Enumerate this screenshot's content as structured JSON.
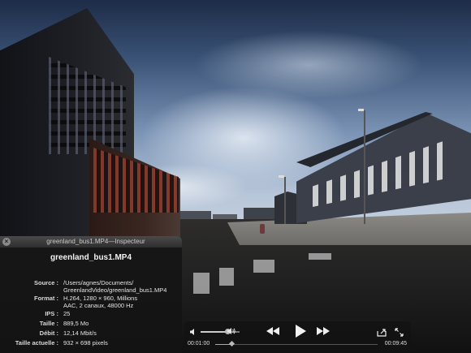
{
  "inspector": {
    "window_title": "greenland_bus1.MP4—Inspecteur",
    "filename": "greenland_bus1.MP4",
    "close_icon": "close-icon",
    "rows": [
      {
        "label": "Source :",
        "lines": [
          "/Users/agnes/Documents/",
          "GreenlandVideo/greenland_bus1.MP4"
        ]
      },
      {
        "label": "Format :",
        "lines": [
          "H.264, 1280 × 960, Millions",
          "AAC, 2 canaux, 48000 Hz"
        ]
      },
      {
        "label": "IPS :",
        "lines": [
          "25"
        ]
      },
      {
        "label": "Taille :",
        "lines": [
          "889,5 Mo"
        ]
      },
      {
        "label": "Débit :",
        "lines": [
          "12,14 Mbit/s"
        ]
      },
      {
        "label": "Taille actuelle :",
        "lines": [
          "932 × 698 pixels"
        ]
      }
    ]
  },
  "player": {
    "time_elapsed": "00:01:00",
    "time_total": "00:09:45",
    "progress_fraction": 0.103,
    "volume_fraction": 0.7,
    "icons": {
      "volume_low": "speaker-low-icon",
      "volume_high": "speaker-high-icon",
      "rewind": "rewind-icon",
      "play": "play-icon",
      "fast_forward": "fast-forward-icon",
      "share": "share-icon",
      "fullscreen": "fullscreen-icon"
    }
  }
}
